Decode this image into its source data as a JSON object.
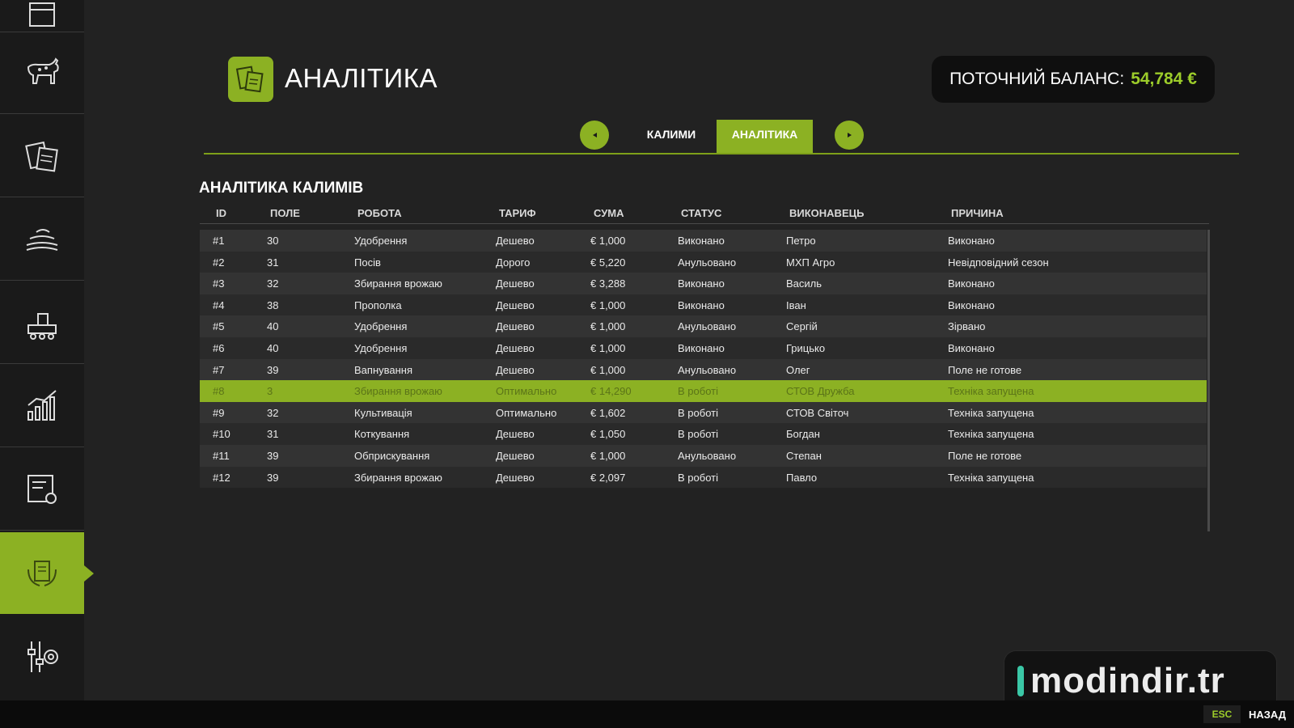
{
  "header": {
    "title": "АНАЛІТИКА",
    "balance_label": "ПОТОЧНИЙ БАЛАНС:",
    "balance_value": "54,784 €"
  },
  "tabs": [
    {
      "label": "КАЛИМИ",
      "active": false
    },
    {
      "label": "АНАЛІТИКА",
      "active": true
    }
  ],
  "section_title": "АНАЛІТИКА КАЛИМІВ",
  "table": {
    "columns": [
      "ID",
      "ПОЛЕ",
      "РОБОТА",
      "ТАРИФ",
      "СУМА",
      "СТАТУС",
      "ВИКОНАВЕЦЬ",
      "ПРИЧИНА"
    ],
    "rows": [
      [
        "#1",
        "30",
        "Удобрення",
        "Дешево",
        "€ 1,000",
        "Виконано",
        "Петро",
        "Виконано"
      ],
      [
        "#2",
        "31",
        "Посів",
        "Дорого",
        "€ 5,220",
        "Анульовано",
        "МХП Агро",
        "Невідповідний сезон"
      ],
      [
        "#3",
        "32",
        "Збирання врожаю",
        "Дешево",
        "€ 3,288",
        "Виконано",
        "Василь",
        "Виконано"
      ],
      [
        "#4",
        "38",
        "Прополка",
        "Дешево",
        "€ 1,000",
        "Виконано",
        "Іван",
        "Виконано"
      ],
      [
        "#5",
        "40",
        "Удобрення",
        "Дешево",
        "€ 1,000",
        "Анульовано",
        "Сергій",
        "Зірвано"
      ],
      [
        "#6",
        "40",
        "Удобрення",
        "Дешево",
        "€ 1,000",
        "Виконано",
        "Грицько",
        "Виконано"
      ],
      [
        "#7",
        "39",
        "Вапнування",
        "Дешево",
        "€ 1,000",
        "Анульовано",
        "Олег",
        "Поле не готове"
      ],
      [
        "#8",
        "3",
        "Збирання врожаю",
        "Оптимально",
        "€ 14,290",
        "В роботі",
        "СТОВ Дружба",
        "Техніка запущена"
      ],
      [
        "#9",
        "32",
        "Культивація",
        "Оптимально",
        "€ 1,602",
        "В роботі",
        "СТОВ Світоч",
        "Техніка запущена"
      ],
      [
        "#10",
        "31",
        "Коткування",
        "Дешево",
        "€ 1,050",
        "В роботі",
        "Богдан",
        "Техніка запущена"
      ],
      [
        "#11",
        "39",
        "Обприскування",
        "Дешево",
        "€ 1,000",
        "Анульовано",
        "Степан",
        "Поле не готове"
      ],
      [
        "#12",
        "39",
        "Збирання врожаю",
        "Дешево",
        "€ 2,097",
        "В роботі",
        "Павло",
        "Техніка запущена"
      ]
    ],
    "highlighted_row": 7
  },
  "sidebar": {
    "items": [
      {
        "icon": "calendar-icon"
      },
      {
        "icon": "animals-icon"
      },
      {
        "icon": "contracts-icon"
      },
      {
        "icon": "production-icon"
      },
      {
        "icon": "factory-icon"
      },
      {
        "icon": "statistics-icon"
      },
      {
        "icon": "vehicle-finance-icon"
      },
      {
        "icon": "farm-contracts-icon",
        "active": true
      },
      {
        "icon": "settings-icon"
      }
    ]
  },
  "watermark": "modindir.tr",
  "footer": {
    "esc_label": "ESC",
    "back_label": "НАЗАД"
  },
  "colors": {
    "accent": "#8cb123",
    "balance": "#9ccc2a",
    "watermark_bar": "#3ac7a6"
  }
}
